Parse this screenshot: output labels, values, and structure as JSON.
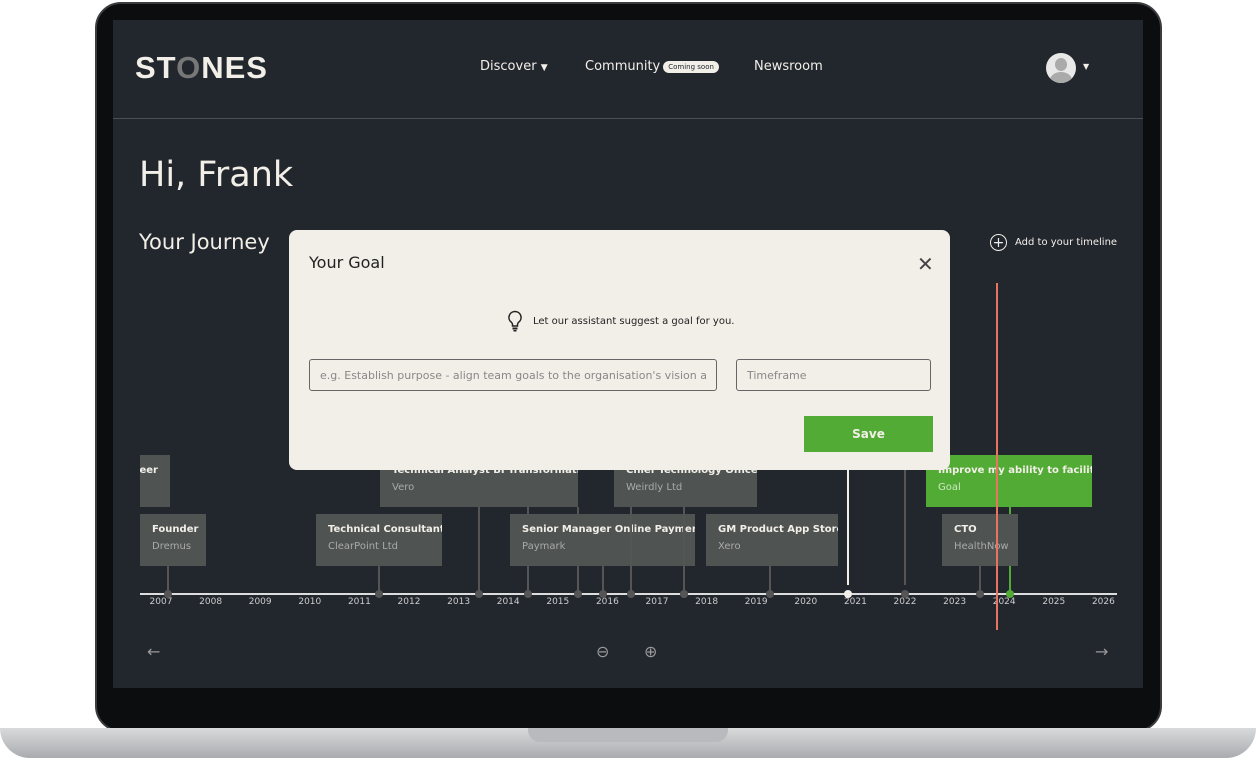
{
  "header": {
    "logo": "STONES",
    "nav": [
      {
        "label": "Discover",
        "dropdown": true
      },
      {
        "label": "Community",
        "badge": "Coming soon"
      },
      {
        "label": "Newsroom"
      }
    ]
  },
  "greeting": "Hi, Frank",
  "journey": {
    "title": "Your Journey",
    "add_label": "Add to your timeline"
  },
  "timeline": {
    "years": [
      "2007",
      "2008",
      "2009",
      "2010",
      "2011",
      "2012",
      "2013",
      "2014",
      "2015",
      "2016",
      "2017",
      "2018",
      "2019",
      "2020",
      "2021",
      "2022",
      "2023",
      "2024",
      "2025",
      "2026"
    ],
    "cards": [
      {
        "title": "neer",
        "subtitle": ""
      },
      {
        "title": "Founder",
        "subtitle": "Dremus"
      },
      {
        "title": "Technical Consultant",
        "subtitle": "ClearPoint Ltd"
      },
      {
        "title": "Technical Analyst BI Transformation",
        "subtitle": "Vero"
      },
      {
        "title": "Senior Manager Online Payments",
        "subtitle": "Paymark"
      },
      {
        "title": "Chief Technology Officer",
        "subtitle": "Weirdly Ltd"
      },
      {
        "title": "GM Product App Store",
        "subtitle": "Xero"
      },
      {
        "title": "Improve my ability to facilita...",
        "subtitle": "Goal"
      },
      {
        "title": "CTO",
        "subtitle": "HealthNow"
      }
    ],
    "colors": {
      "goal": "#52ab34",
      "today_marker": "#e8735f",
      "card": "#4f5352"
    }
  },
  "modal": {
    "title": "Your Goal",
    "hint": "Let our assistant suggest a goal for you.",
    "goal_placeholder": "e.g. Establish purpose - align team goals to the organisation's vision and values",
    "timeframe_placeholder": "Timeframe",
    "save_label": "Save"
  }
}
